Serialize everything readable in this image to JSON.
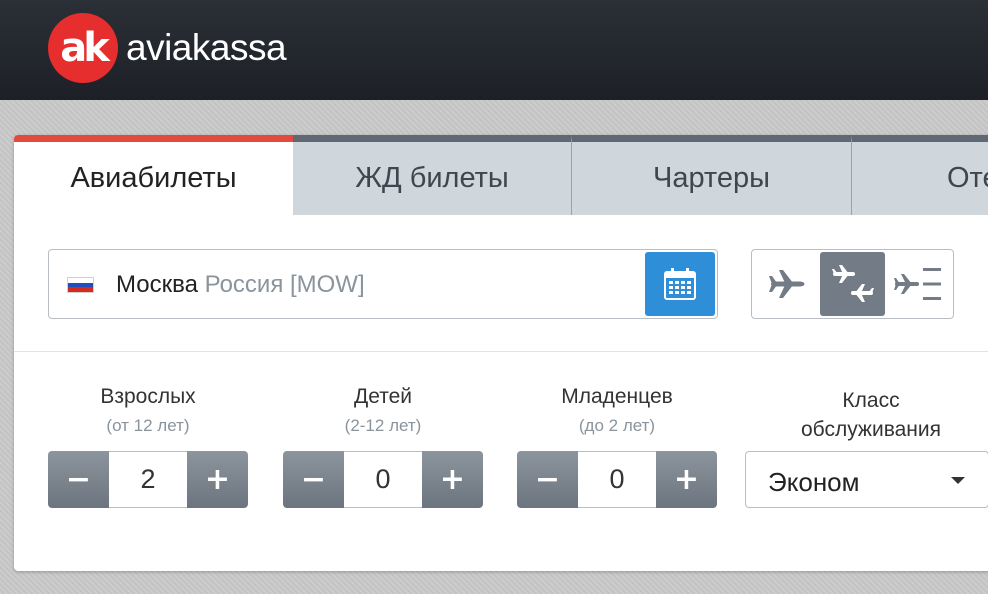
{
  "header": {
    "logo_mark": "ak",
    "logo_text": "aviakassa"
  },
  "colors": {
    "brand_red": "#e62e2e",
    "accent_blue": "#2e8fd8",
    "header_bg": "#22262d",
    "active_tab_accent": "#e24a3b"
  },
  "tabs": [
    {
      "label": "Авиабилеты",
      "active": true
    },
    {
      "label": "ЖД билеты",
      "active": false
    },
    {
      "label": "Чартеры",
      "active": false
    },
    {
      "label": "Отели",
      "active": false
    }
  ],
  "route": {
    "flag_icon": "russia-flag-icon",
    "city": "Москва",
    "country_code": "Россия [MOW]",
    "calendar_icon": "calendar-icon"
  },
  "trip_modes": [
    {
      "icon": "plane-one-way-icon",
      "active": false
    },
    {
      "icon": "plane-round-trip-icon",
      "active": true
    },
    {
      "icon": "plane-multi-city-icon",
      "active": false
    }
  ],
  "passengers": [
    {
      "label": "Взрослых",
      "sublabel": "(от 12 лет)",
      "value": "2",
      "minus": "−",
      "plus": "+"
    },
    {
      "label": "Детей",
      "sublabel": "(2-12 лет)",
      "value": "0",
      "minus": "−",
      "plus": "+"
    },
    {
      "label": "Младенцев",
      "sublabel": "(до 2 лет)",
      "value": "0",
      "minus": "−",
      "plus": "+"
    }
  ],
  "service_class": {
    "label_line1": "Класс",
    "label_line2": "обслуживания",
    "selected": "Эконом"
  }
}
